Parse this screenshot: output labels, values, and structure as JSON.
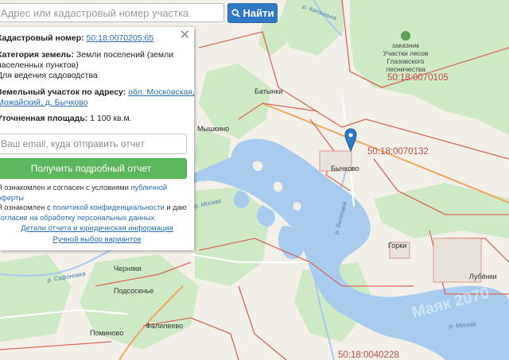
{
  "search": {
    "placeholder": "Адрес или кадастровый номер участка",
    "button_label": "Найти"
  },
  "panel": {
    "rows": [
      {
        "label": "Кадастровый номер:",
        "value": "",
        "link": "50:18:0070205:65"
      },
      {
        "label": "Категория земель:",
        "value": " Земли поселений (земли",
        "link": ""
      },
      {
        "label": "",
        "value": "населенных пунктов)",
        "link": ""
      },
      {
        "label": "",
        "value": "Для ведения садоводства",
        "link": ""
      },
      {
        "label": "Земельный участок по адресу:",
        "value": "",
        "link": "обл. Московская, р-н"
      },
      {
        "label": "",
        "value": "",
        "link": "Можайский, д. Бычково"
      },
      {
        "label": "Уточненная площадь:",
        "value": " 1 100 кв.м.",
        "link": ""
      }
    ],
    "email_placeholder": "Ваш email, куда отправить отчет",
    "report_button": "Получить подробный отчет",
    "consent_1a": "Я ознакомлен и согласен с условиями ",
    "consent_1b": "публичной оферты",
    "consent_2a": "Я ознакомлен с ",
    "consent_2b": "политикой конфиденциальности",
    "consent_2c": " и даю",
    "consent_3": "согласие на обработку персональных данных",
    "details_link": "Детали отчета и юридическая информация",
    "manual_link": "Ручной выбор вариантов"
  },
  "map": {
    "places": [
      "Батынки",
      "Мышкино",
      "Бычково",
      "Горки",
      "Лубёнки",
      "Черняки",
      "Подсосенье",
      "Фалилеево",
      "Поминово"
    ],
    "rivers": [
      "р. Москва",
      "р. Бычковка",
      "р. Сафоновка",
      "р. Москва",
      "р. Катынька"
    ],
    "cadastral": [
      "50:18:0070105",
      "50:18:0070132",
      "50:18:0040228"
    ],
    "reserve": [
      "заказник",
      "Участки лесов",
      "Глазовского",
      "лесничества"
    ],
    "watermark": "Маяк 2070"
  },
  "colors": {
    "water": "#a9cbee",
    "forest": "#cfe8c6",
    "border": "#d96a5c",
    "accent": "#2f79c7",
    "button_green": "#5cb85c"
  }
}
